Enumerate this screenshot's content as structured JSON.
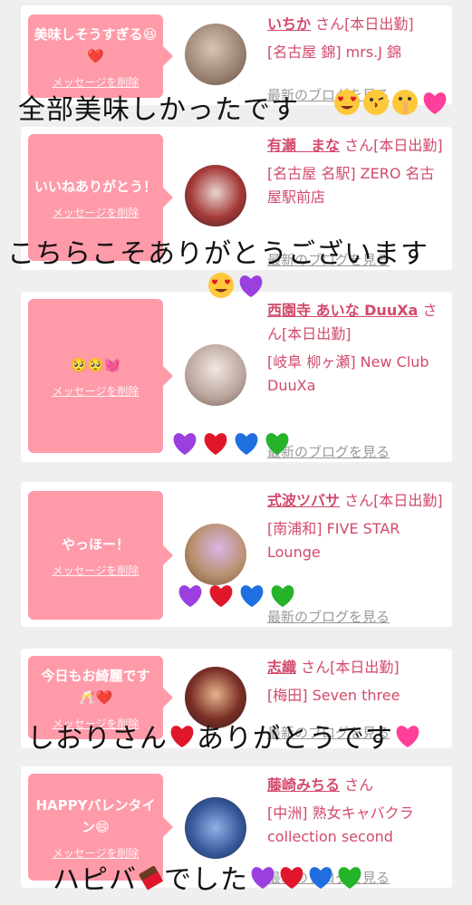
{
  "colors": {
    "bubble": "#ff9aa9",
    "name": "#d24a6b",
    "blog_link": "#999999",
    "heart_purple": "#9b3fe0",
    "heart_red": "#e0172a",
    "heart_blue": "#1f6fe0",
    "heart_green": "#25b32a",
    "heart_pink": "#ff3f9a"
  },
  "cards": [
    {
      "message": "美味しそうすぎる😆❤️",
      "delete": "メッセージを削除",
      "name": "いちか",
      "suffix": "さん[本日出勤]",
      "shop": "[名古屋 錦] mrs.J 錦",
      "blog": "最新のブログを見る"
    },
    {
      "message": "いいねありがとう！",
      "delete": "メッセージを削除",
      "name": "有瀬　まな",
      "suffix": "さん[本日出勤]",
      "shop": "[名古屋 名駅] ZERO 名古屋駅前店",
      "blog": "最新のブログを見る"
    },
    {
      "message": "🥺🥺💓",
      "delete": "メッセージを削除",
      "name": "西園寺 あいな DuuXa",
      "suffix": "さん[本日出勤]",
      "shop": "[岐阜 柳ヶ瀬] New Club DuuXa",
      "blog": "最新のブログを見る"
    },
    {
      "message": "やっほー！",
      "delete": "メッセージを削除",
      "name": "式波ツバサ",
      "suffix": "さん[本日出勤]",
      "shop": "[南浦和] FIVE STAR Lounge",
      "blog": "最新のブログを見る"
    },
    {
      "message": "今日もお綺麗です🥂❤️",
      "delete": "メッセージを削除",
      "name": "志織",
      "suffix": "さん[本日出勤]",
      "shop": "[梅田] Seven three",
      "blog": "最新のブログを見る"
    },
    {
      "message": "HAPPYバレンタイン😄",
      "delete": "メッセージを削除",
      "name": "藤崎みちる",
      "suffix": "さん",
      "shop": "[中洲] 熟女キャバクラ collection second",
      "blog": "最新のブログを見る"
    }
  ],
  "overlays": {
    "line1": "全部美味しかったです",
    "line2": "こちらこそありがとうございます",
    "line3": "しおりさん",
    "line3b": "ありがとうです",
    "line4": "ハピバ",
    "line4b": "でした"
  }
}
